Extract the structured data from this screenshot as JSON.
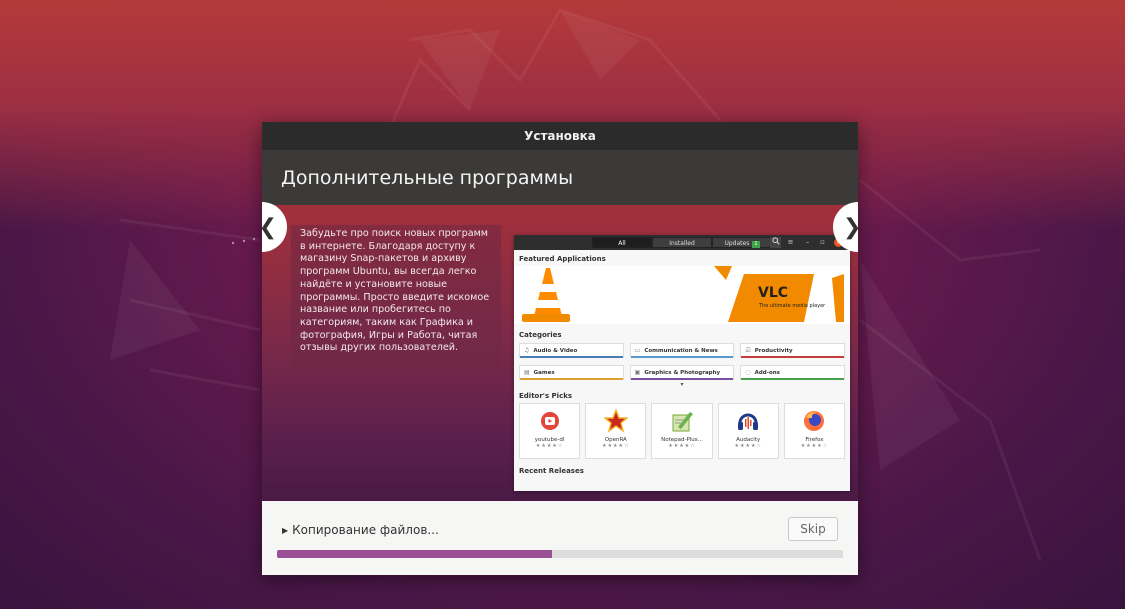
{
  "window": {
    "title": "Установка"
  },
  "page": {
    "heading": "Дополнительные программы"
  },
  "slide": {
    "description": "Забудьте про поиск новых программ в интернете. Благодаря доступу к магазину Snap-пакетов и архиву программ Ubuntu, вы всегда легко найдёте и установите новые программы. Просто введите искомое название или пробегитесь по категориям, таким как Графика и фотография, Игры и Работа, читая отзывы других пользователей.",
    "prev_icon": "chevron-left-icon",
    "next_icon": "chevron-right-icon",
    "store": {
      "tabs": [
        "All",
        "Installed",
        "Updates"
      ],
      "updates_count": "1",
      "featured_title": "Featured Applications",
      "banner_title": "VLC",
      "banner_subtitle": "The ultimate media player",
      "categories_title": "Categories",
      "categories": [
        "Audio & Video",
        "Communication & News",
        "Productivity",
        "Games",
        "Graphics & Photography",
        "Add-ons"
      ],
      "picks_title": "Editor's Picks",
      "picks": [
        {
          "name": "youtube-dl",
          "stars": "★★★★☆"
        },
        {
          "name": "OpenRA",
          "stars": "★★★★☆"
        },
        {
          "name": "Notepad-Plus...",
          "stars": "★★★★☆"
        },
        {
          "name": "Audacity",
          "stars": "★★★★☆"
        },
        {
          "name": "Firefox",
          "stars": "★★★★☆"
        }
      ],
      "recent_title": "Recent Releases"
    }
  },
  "footer": {
    "status": "Копирование файлов...",
    "skip_label": "Skip",
    "progress": 0.485
  },
  "colors": {
    "accent": "#9b4f96",
    "header_bg": "#3b3a38",
    "titlebar_bg": "#2b2b2b"
  }
}
